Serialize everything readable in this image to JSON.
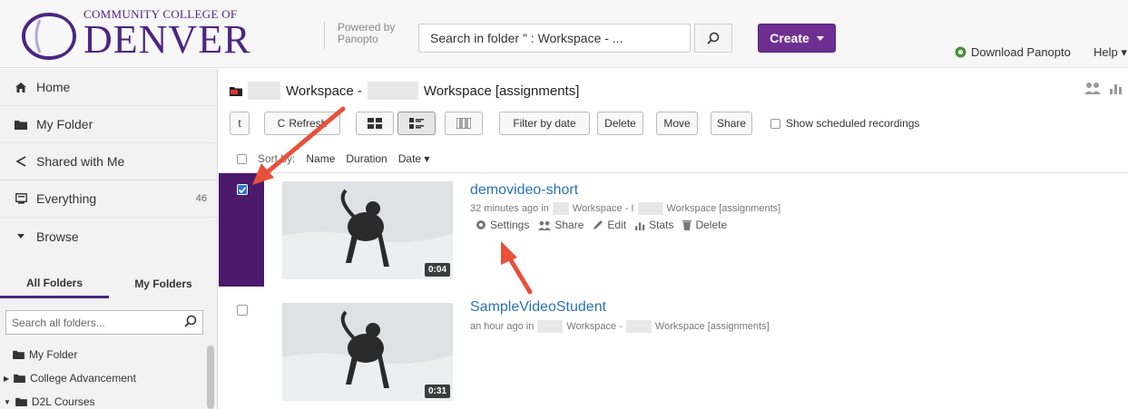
{
  "header": {
    "logo_top": "COMMUNITY COLLEGE OF",
    "logo_main": "DENVER",
    "powered_by": "Powered by",
    "powered_name": "Panopto",
    "search_text": "Search in folder \"   : Workspace -     ...",
    "create_label": "Create",
    "download_label": "Download Panopto",
    "help_label": "Help"
  },
  "sidebar": {
    "items": [
      {
        "label": "Home",
        "icon": "home-icon"
      },
      {
        "label": "My Folder",
        "icon": "folder-icon"
      },
      {
        "label": "Shared with Me",
        "icon": "share-icon"
      },
      {
        "label": "Everything",
        "icon": "everything-icon",
        "count": "46"
      },
      {
        "label": "Browse",
        "icon": "caret-down-icon"
      }
    ],
    "tabs": [
      "All Folders",
      "My Folders"
    ],
    "folder_search_placeholder": "Search all folders...",
    "tree": [
      "My Folder",
      "College Advancement",
      "D2L Courses"
    ]
  },
  "main": {
    "title_part1": "Workspace -",
    "title_part2": "Workspace [assignments]",
    "toolbar": {
      "up_label": "t",
      "refresh_label": "Refresh",
      "filter_label": "Filter by date",
      "delete_label": "Delete",
      "move_label": "Move",
      "share_label": "Share",
      "show_scheduled_label": "Show scheduled recordings"
    },
    "sort": {
      "prefix": "Sort by:",
      "name": "Name",
      "duration": "Duration",
      "date": "Date"
    },
    "videos": [
      {
        "title": "demovideo-short",
        "meta_prefix": "32 minutes ago in",
        "meta_ws": "Workspace - I",
        "meta_assign": "Workspace [assignments]",
        "duration": "0:04",
        "selected": true,
        "actions": [
          "Settings",
          "Share",
          "Edit",
          "Stats",
          "Delete"
        ]
      },
      {
        "title": "SampleVideoStudent",
        "meta_prefix": "an hour ago in",
        "meta_ws": "Workspace -",
        "meta_assign": "Workspace [assignments]",
        "duration": "0:31",
        "selected": false
      }
    ]
  },
  "colors": {
    "brand": "#4b2682",
    "create": "#6e2f92",
    "link": "#2a73b8",
    "selection": "#4b1a6c",
    "arrow": "#e8503a"
  }
}
